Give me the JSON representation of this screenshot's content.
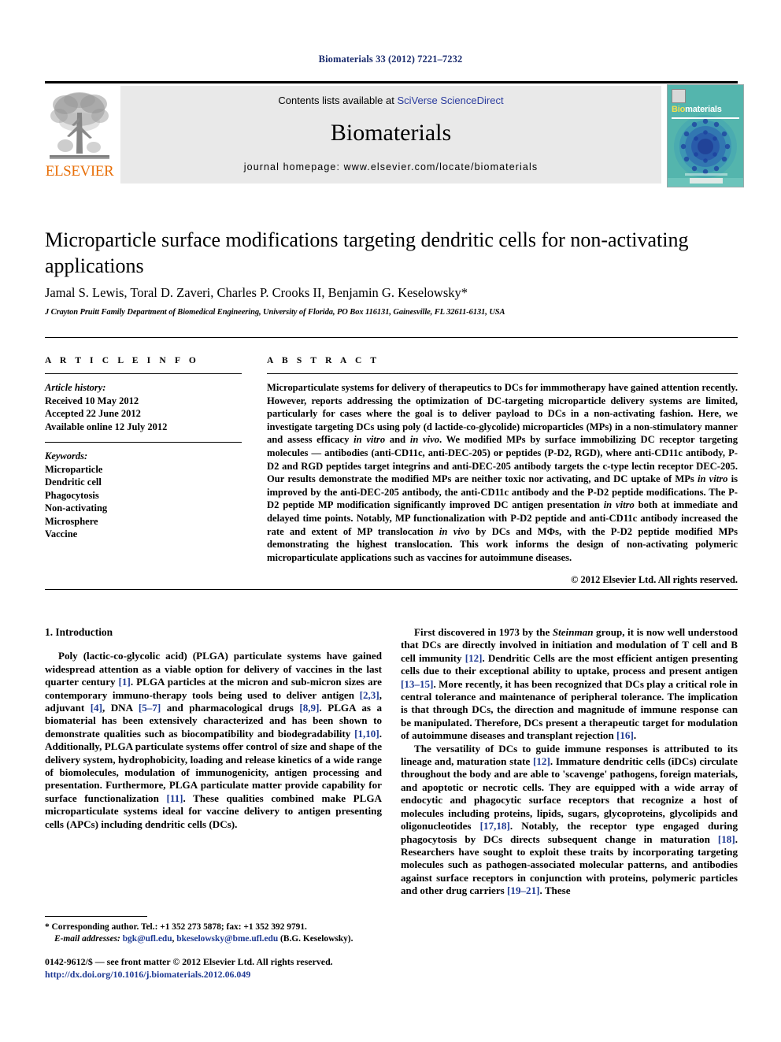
{
  "running_head": "Biomaterials 33 (2012) 7221–7232",
  "masthead": {
    "contents_prefix": "Contents lists available at ",
    "sciencedirect": "SciVerse ScienceDirect",
    "journal_name": "Biomaterials",
    "homepage": "journal homepage: www.elsevier.com/locate/biomaterials",
    "publisher": "ELSEVIER",
    "cover": {
      "title_first": "Bio",
      "title_rest": "materials"
    },
    "link_color": "#2a3b9e",
    "publisher_color": "#E8700A",
    "band_color": "#e9e9e9"
  },
  "article": {
    "title": "Microparticle surface modifications targeting dendritic cells for non-activating applications",
    "authors": "Jamal S. Lewis, Toral D. Zaveri, Charles P. Crooks II, Benjamin G. Keselowsky*",
    "affiliation": "J Crayton Pruitt Family Department of Biomedical Engineering, University of Florida, PO Box 116131, Gainesville, FL 32611-6131, USA"
  },
  "info": {
    "heading": "A R T I C L E   I N F O",
    "history_label": "Article history:",
    "history": [
      "Received 10 May 2012",
      "Accepted 22 June 2012",
      "Available online 12 July 2012"
    ],
    "keywords_label": "Keywords:",
    "keywords": [
      "Microparticle",
      "Dendritic cell",
      "Phagocytosis",
      "Non-activating",
      "Microsphere",
      "Vaccine"
    ]
  },
  "abstract": {
    "heading": "A B S T R A C T",
    "paragraph_1": "Microparticulate systems for delivery of therapeutics to DCs for immmotherapy have gained attention recently. However, reports addressing the optimization of DC-targeting microparticle delivery systems are limited, particularly for cases where the goal is to deliver payload to DCs in a non-activating fashion. Here, we investigate targeting DCs using poly (d lactide-co-glycolide) microparticles (MPs) in a non-stimulatory manner and assess efficacy ",
    "italic_1": "in vitro",
    "paragraph_1b": " and ",
    "italic_2": "in vivo",
    "paragraph_1c": ". We modified MPs by surface immobilizing DC receptor targeting molecules — antibodies (anti-CD11c, anti-DEC-205) or peptides (P-D2, RGD), where anti-CD11c antibody, P-D2 and RGD peptides target integrins and anti-DEC-205 antibody targets the c-type lectin receptor DEC-205. Our results demonstrate the modified MPs are neither toxic nor activating, and DC uptake of MPs ",
    "italic_3": "in vitro",
    "paragraph_1d": " is improved by the anti-DEC-205 antibody, the anti-CD11c antibody and the P-D2 peptide modifications. The P-D2 peptide MP modification significantly improved DC antigen presentation ",
    "italic_4": "in vitro",
    "paragraph_1e": " both at immediate and delayed time points. Notably, MP functionalization with P-D2 peptide and anti-CD11c antibody increased the rate and extent of MP translocation ",
    "italic_5": "in vivo",
    "paragraph_1f": " by DCs and MΦs, with the P-D2 peptide modified MPs demonstrating the highest translocation. This work informs the design of non-activating polymeric microparticulate applications such as vaccines for autoimmune diseases.",
    "copyright": "© 2012 Elsevier Ltd. All rights reserved."
  },
  "introduction": {
    "heading": "1.  Introduction",
    "left_paragraph_1": "Poly (lactic-co-glycolic acid) (PLGA) particulate systems have gained widespread attention as a viable option for delivery of vaccines in the last quarter century [1]. PLGA particles at the micron and sub-micron sizes are contemporary immuno-therapy tools being used to deliver antigen [2,3], adjuvant [4], DNA [5–7] and pharmacological drugs [8,9]. PLGA as a biomaterial has been extensively characterized and has been shown to demonstrate qualities such as biocompatibility and biodegradability [1,10]. Additionally, PLGA particulate systems offer control of size and shape of the delivery system, hydrophobicity, loading and release kinetics of a wide range of biomolecules, modulation of immunogenicity, antigen processing and presentation. Furthermore, PLGA particulate matter provide capability for surface functionalization [11]. These qualities combined make PLGA microparticulate systems ideal for vaccine delivery to antigen presenting cells (APCs) including dendritic cells (DCs).",
    "right_paragraph_1": "First discovered in 1973 by the Steinman group, it is now well understood that DCs are directly involved in initiation and modulation of T cell and B cell immunity [12]. Dendritic Cells are the most efficient antigen presenting cells due to their exceptional ability to uptake, process and present antigen [13–15]. More recently, it has been recognized that DCs play a critical role in central tolerance and maintenance of peripheral tolerance. The implication is that through DCs, the direction and magnitude of immune response can be manipulated. Therefore, DCs present a therapeutic target for modulation of autoimmune diseases and transplant rejection [16].",
    "right_paragraph_2": "The versatility of DCs to guide immune responses is attributed to its lineage and, maturation state [12]. Immature dendritic cells (iDCs) circulate throughout the body and are able to 'scavenge' pathogens, foreign materials, and apoptotic or necrotic cells. They are equipped with a wide array of endocytic and phagocytic surface receptors that recognize a host of molecules including proteins, lipids, sugars, glycoproteins, glycolipids and oligonucleotides [17,18]. Notably, the receptor type engaged during phagocytosis by DCs directs subsequent change in maturation [18]. Researchers have sought to exploit these traits by incorporating targeting molecules such as pathogen-associated molecular patterns, and antibodies against surface receptors in conjunction with proteins, polymeric particles and other drug carriers [19–21]. These"
  },
  "footnote": {
    "corresponding": "* Corresponding author. Tel.: +1 352 273 5878; fax: +1 352 392 9791.",
    "email_label": "E-mail addresses:",
    "email_1": "bgk@ufl.edu",
    "email_sep": ", ",
    "email_2": "bkeselowsky@bme.ufl.edu",
    "email_suffix": " (B.G. Keselowsky)."
  },
  "imprint": {
    "line_1": "0142-9612/$ — see front matter © 2012 Elsevier Ltd. All rights reserved.",
    "doi": "http://dx.doi.org/10.1016/j.biomaterials.2012.06.049"
  }
}
